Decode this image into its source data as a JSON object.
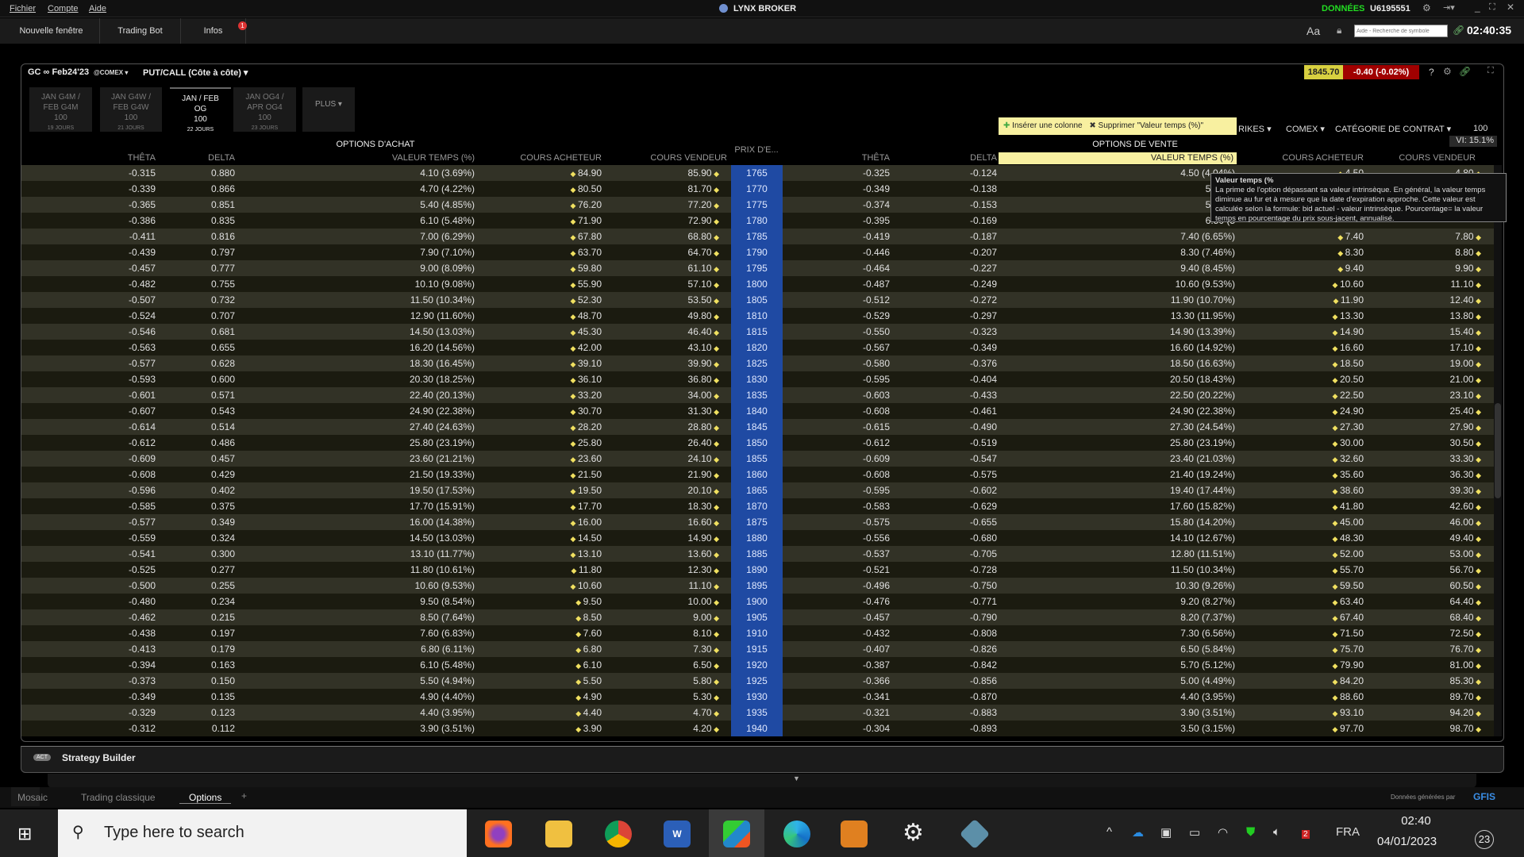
{
  "menu": [
    "Fichier",
    "Compte",
    "Aide"
  ],
  "app_title": "LYNX BROKER",
  "data_label": "DONNÉES",
  "account": "U6195551",
  "toolbar": {
    "new_window": "Nouvelle fenêtre",
    "trading_bot": "Trading Bot",
    "infos": "Infos",
    "infos_badge": "1",
    "font_btn": "Aa",
    "search_placeholder": "Aide - Recherche de symbole",
    "clock": "02:40:35"
  },
  "panel": {
    "symbol": "GC ∞ Feb24'23",
    "exchange": "@COMEX ▾",
    "view": "PUT/CALL (Côte à côte) ▾",
    "last": "1845.70",
    "change": "-0.40 (-0.02%)",
    "help": "?"
  },
  "expiries": [
    {
      "l1": "JAN G4M /",
      "l2": "FEB G4M",
      "mult": "100",
      "days": "19 JOURS",
      "active": false
    },
    {
      "l1": "JAN G4W /",
      "l2": "FEB G4W",
      "mult": "100",
      "days": "21 JOURS",
      "active": false
    },
    {
      "l1": "JAN / FEB",
      "l2": "OG",
      "mult": "100",
      "days": "22 JOURS",
      "active": true
    },
    {
      "l1": "JAN OG4 /",
      "l2": "APR OG4",
      "mult": "100",
      "days": "23 JOURS",
      "active": false
    }
  ],
  "more": "PLUS ▾",
  "context": {
    "insert": "Insérer une colonne",
    "remove": "Supprimer \"Valeur temps (%)\""
  },
  "filters": {
    "strikes": "RIKES ▾",
    "exchange": "COMEX ▾",
    "category": "CATÉGORIE DE CONTRAT ▾",
    "mult": "100"
  },
  "vi": "VI: 15.1%",
  "calls_title": "OPTIONS D'ACHAT",
  "puts_title": "OPTIONS DE VENTE",
  "strike_header": "PRIX D'E...",
  "columns": [
    "THÊTA",
    "DELTA",
    "VALEUR TEMPS (%)",
    "COURS ACHETEUR",
    "COURS VENDEUR"
  ],
  "tooltip": {
    "title": "Valeur temps (%",
    "body": "La prime de l'option dépassant sa valeur intrinsèque. En général, la valeur temps diminue au fur et à mesure que la date d'expiration approche. Cette valeur est calculée selon la formule: bid actuel - valeur intrinsèque. Pourcentage= la valeur temps en pourcentage du prix sous-jacent, annualisé."
  },
  "rows": [
    [
      "-0.315",
      "0.880",
      "4.10 (3.69%)",
      "84.90",
      "85.90",
      "1765",
      "-0.325",
      "-0.124",
      "4.50 (4.04%)",
      "4.50",
      "4.80"
    ],
    [
      "-0.339",
      "0.866",
      "4.70 (4.22%)",
      "80.50",
      "81.70",
      "1770",
      "-0.349",
      "-0.138",
      "5.10 (4",
      "",
      ""
    ],
    [
      "-0.365",
      "0.851",
      "5.40 (4.85%)",
      "76.20",
      "77.20",
      "1775",
      "-0.374",
      "-0.153",
      "5.80 (5",
      "",
      ""
    ],
    [
      "-0.386",
      "0.835",
      "6.10 (5.48%)",
      "71.90",
      "72.90",
      "1780",
      "-0.395",
      "-0.169",
      "6.50 (5",
      "",
      ""
    ],
    [
      "-0.411",
      "0.816",
      "7.00 (6.29%)",
      "67.80",
      "68.80",
      "1785",
      "-0.419",
      "-0.187",
      "7.40 (6.65%)",
      "7.40",
      "7.80"
    ],
    [
      "-0.439",
      "0.797",
      "7.90 (7.10%)",
      "63.70",
      "64.70",
      "1790",
      "-0.446",
      "-0.207",
      "8.30 (7.46%)",
      "8.30",
      "8.80"
    ],
    [
      "-0.457",
      "0.777",
      "9.00 (8.09%)",
      "59.80",
      "61.10",
      "1795",
      "-0.464",
      "-0.227",
      "9.40 (8.45%)",
      "9.40",
      "9.90"
    ],
    [
      "-0.482",
      "0.755",
      "10.10 (9.08%)",
      "55.90",
      "57.10",
      "1800",
      "-0.487",
      "-0.249",
      "10.60 (9.53%)",
      "10.60",
      "11.10"
    ],
    [
      "-0.507",
      "0.732",
      "11.50 (10.34%)",
      "52.30",
      "53.50",
      "1805",
      "-0.512",
      "-0.272",
      "11.90 (10.70%)",
      "11.90",
      "12.40"
    ],
    [
      "-0.524",
      "0.707",
      "12.90 (11.60%)",
      "48.70",
      "49.80",
      "1810",
      "-0.529",
      "-0.297",
      "13.30 (11.95%)",
      "13.30",
      "13.80"
    ],
    [
      "-0.546",
      "0.681",
      "14.50 (13.03%)",
      "45.30",
      "46.40",
      "1815",
      "-0.550",
      "-0.323",
      "14.90 (13.39%)",
      "14.90",
      "15.40"
    ],
    [
      "-0.563",
      "0.655",
      "16.20 (14.56%)",
      "42.00",
      "43.10",
      "1820",
      "-0.567",
      "-0.349",
      "16.60 (14.92%)",
      "16.60",
      "17.10"
    ],
    [
      "-0.577",
      "0.628",
      "18.30 (16.45%)",
      "39.10",
      "39.90",
      "1825",
      "-0.580",
      "-0.376",
      "18.50 (16.63%)",
      "18.50",
      "19.00"
    ],
    [
      "-0.593",
      "0.600",
      "20.30 (18.25%)",
      "36.10",
      "36.80",
      "1830",
      "-0.595",
      "-0.404",
      "20.50 (18.43%)",
      "20.50",
      "21.00"
    ],
    [
      "-0.601",
      "0.571",
      "22.40 (20.13%)",
      "33.20",
      "34.00",
      "1835",
      "-0.603",
      "-0.433",
      "22.50 (20.22%)",
      "22.50",
      "23.10"
    ],
    [
      "-0.607",
      "0.543",
      "24.90 (22.38%)",
      "30.70",
      "31.30",
      "1840",
      "-0.608",
      "-0.461",
      "24.90 (22.38%)",
      "24.90",
      "25.40"
    ],
    [
      "-0.614",
      "0.514",
      "27.40 (24.63%)",
      "28.20",
      "28.80",
      "1845",
      "-0.615",
      "-0.490",
      "27.30 (24.54%)",
      "27.30",
      "27.90"
    ],
    [
      "-0.612",
      "0.486",
      "25.80 (23.19%)",
      "25.80",
      "26.40",
      "1850",
      "-0.612",
      "-0.519",
      "25.80 (23.19%)",
      "30.00",
      "30.50"
    ],
    [
      "-0.609",
      "0.457",
      "23.60 (21.21%)",
      "23.60",
      "24.10",
      "1855",
      "-0.609",
      "-0.547",
      "23.40 (21.03%)",
      "32.60",
      "33.30"
    ],
    [
      "-0.608",
      "0.429",
      "21.50 (19.33%)",
      "21.50",
      "21.90",
      "1860",
      "-0.608",
      "-0.575",
      "21.40 (19.24%)",
      "35.60",
      "36.30"
    ],
    [
      "-0.596",
      "0.402",
      "19.50 (17.53%)",
      "19.50",
      "20.10",
      "1865",
      "-0.595",
      "-0.602",
      "19.40 (17.44%)",
      "38.60",
      "39.30"
    ],
    [
      "-0.585",
      "0.375",
      "17.70 (15.91%)",
      "17.70",
      "18.30",
      "1870",
      "-0.583",
      "-0.629",
      "17.60 (15.82%)",
      "41.80",
      "42.60"
    ],
    [
      "-0.577",
      "0.349",
      "16.00 (14.38%)",
      "16.00",
      "16.60",
      "1875",
      "-0.575",
      "-0.655",
      "15.80 (14.20%)",
      "45.00",
      "46.00"
    ],
    [
      "-0.559",
      "0.324",
      "14.50 (13.03%)",
      "14.50",
      "14.90",
      "1880",
      "-0.556",
      "-0.680",
      "14.10 (12.67%)",
      "48.30",
      "49.40"
    ],
    [
      "-0.541",
      "0.300",
      "13.10 (11.77%)",
      "13.10",
      "13.60",
      "1885",
      "-0.537",
      "-0.705",
      "12.80 (11.51%)",
      "52.00",
      "53.00"
    ],
    [
      "-0.525",
      "0.277",
      "11.80 (10.61%)",
      "11.80",
      "12.30",
      "1890",
      "-0.521",
      "-0.728",
      "11.50 (10.34%)",
      "55.70",
      "56.70"
    ],
    [
      "-0.500",
      "0.255",
      "10.60 (9.53%)",
      "10.60",
      "11.10",
      "1895",
      "-0.496",
      "-0.750",
      "10.30 (9.26%)",
      "59.50",
      "60.50"
    ],
    [
      "-0.480",
      "0.234",
      "9.50 (8.54%)",
      "9.50",
      "10.00",
      "1900",
      "-0.476",
      "-0.771",
      "9.20 (8.27%)",
      "63.40",
      "64.40"
    ],
    [
      "-0.462",
      "0.215",
      "8.50 (7.64%)",
      "8.50",
      "9.00",
      "1905",
      "-0.457",
      "-0.790",
      "8.20 (7.37%)",
      "67.40",
      "68.40"
    ],
    [
      "-0.438",
      "0.197",
      "7.60 (6.83%)",
      "7.60",
      "8.10",
      "1910",
      "-0.432",
      "-0.808",
      "7.30 (6.56%)",
      "71.50",
      "72.50"
    ],
    [
      "-0.413",
      "0.179",
      "6.80 (6.11%)",
      "6.80",
      "7.30",
      "1915",
      "-0.407",
      "-0.826",
      "6.50 (5.84%)",
      "75.70",
      "76.70"
    ],
    [
      "-0.394",
      "0.163",
      "6.10 (5.48%)",
      "6.10",
      "6.50",
      "1920",
      "-0.387",
      "-0.842",
      "5.70 (5.12%)",
      "79.90",
      "81.00"
    ],
    [
      "-0.373",
      "0.150",
      "5.50 (4.94%)",
      "5.50",
      "5.80",
      "1925",
      "-0.366",
      "-0.856",
      "5.00 (4.49%)",
      "84.20",
      "85.30"
    ],
    [
      "-0.349",
      "0.135",
      "4.90 (4.40%)",
      "4.90",
      "5.30",
      "1930",
      "-0.341",
      "-0.870",
      "4.40 (3.95%)",
      "88.60",
      "89.70"
    ],
    [
      "-0.329",
      "0.123",
      "4.40 (3.95%)",
      "4.40",
      "4.70",
      "1935",
      "-0.321",
      "-0.883",
      "3.90 (3.51%)",
      "93.10",
      "94.20"
    ],
    [
      "-0.312",
      "0.112",
      "3.90 (3.51%)",
      "3.90",
      "4.20",
      "1940",
      "-0.304",
      "-0.893",
      "3.50 (3.15%)",
      "97.70",
      "98.70"
    ]
  ],
  "strategy_builder": {
    "badge": "ACT",
    "label": "Strategy Builder"
  },
  "bottom_tabs": [
    "Mosaic",
    "Trading classique",
    "Options",
    "+"
  ],
  "active_tab": "Options",
  "credits": "Données générées par",
  "credits_brand": "GFIS",
  "taskbar": {
    "search_placeholder": "Type here to search",
    "lang": "FRA",
    "time": "02:40",
    "date": "04/01/2023",
    "notif_count": "23",
    "tray_badge": "2"
  },
  "colors": {
    "strike_bg": "#1f4aa3",
    "last_bg": "#d8d040",
    "change_bg": "#a00000",
    "highlight": "#f8f0a0",
    "data_green": "#22dd22"
  }
}
